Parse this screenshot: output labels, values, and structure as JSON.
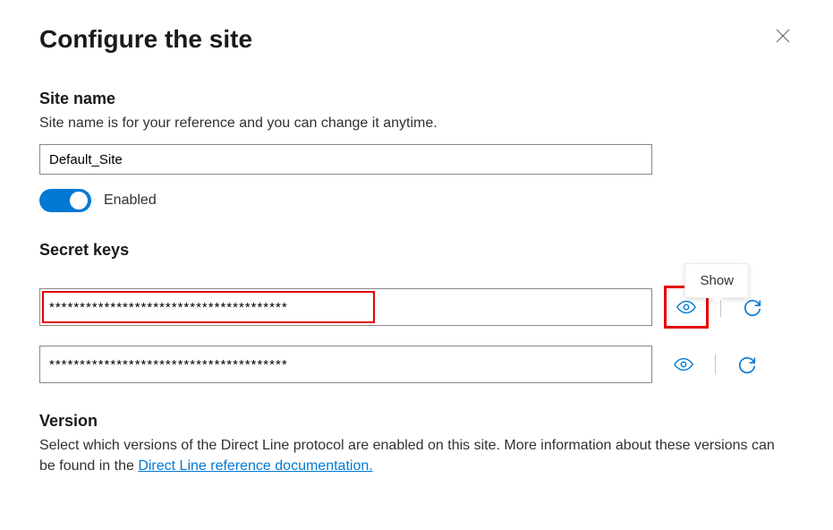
{
  "header": {
    "title": "Configure the site"
  },
  "siteName": {
    "heading": "Site name",
    "description": "Site name is for your reference and you can change it anytime.",
    "value": "Default_Site",
    "toggleLabel": "Enabled"
  },
  "secretKeys": {
    "heading": "Secret keys",
    "tooltip": "Show",
    "key1": "***************************************",
    "key2": "***************************************"
  },
  "version": {
    "heading": "Version",
    "descriptionPart1": "Select which versions of the Direct Line protocol are enabled on this site. More information about these versions can be found in the ",
    "linkText": "Direct Line reference documentation."
  }
}
